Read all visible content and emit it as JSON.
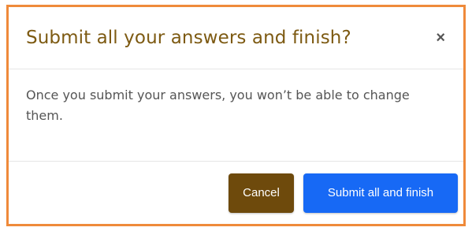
{
  "modal": {
    "title": "Submit all your answers and finish?",
    "close_glyph": "×",
    "body_text": "Once you submit your answers, you won’t be able to change them."
  },
  "footer": {
    "cancel_label": "Cancel",
    "submit_label": "Submit all and finish"
  },
  "colors": {
    "modal_border": "#ef8a3a",
    "title_text": "#7d5a12",
    "cancel_button": "#6e4a0c",
    "submit_button": "#1769f5"
  },
  "icons": {
    "close": "close-icon"
  }
}
